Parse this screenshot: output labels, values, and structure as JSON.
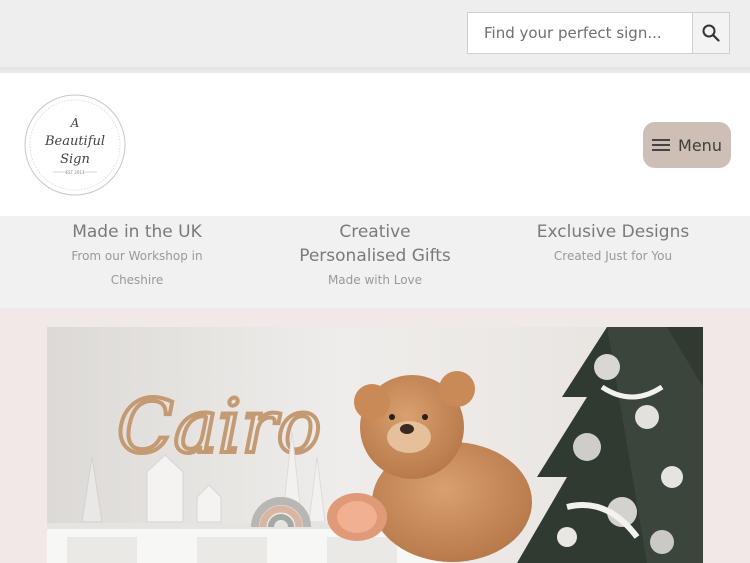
{
  "search": {
    "placeholder": "Find your perfect sign..."
  },
  "header": {
    "logo": {
      "line1": "A",
      "line2": "Beautiful",
      "line3": "Sign",
      "badge": "EST 2013"
    },
    "menu_label": "Menu"
  },
  "usp": [
    {
      "title": "Made in the UK",
      "sub1": "From our Workshop in",
      "sub2": "Cheshire"
    },
    {
      "title": "Creative",
      "title2": "Personalised Gifts",
      "sub1": "Made with Love"
    },
    {
      "title": "Exclusive Designs",
      "sub1": "Created Just for You"
    }
  ],
  "hero": {
    "sign_text": "Cairo"
  },
  "colors": {
    "menu_bg": "#cdbfb5",
    "page_bg": "#f1e9e8",
    "usp_bg": "#f1f1f1"
  },
  "icons": {
    "search": "search-icon",
    "menu": "hamburger-icon"
  }
}
